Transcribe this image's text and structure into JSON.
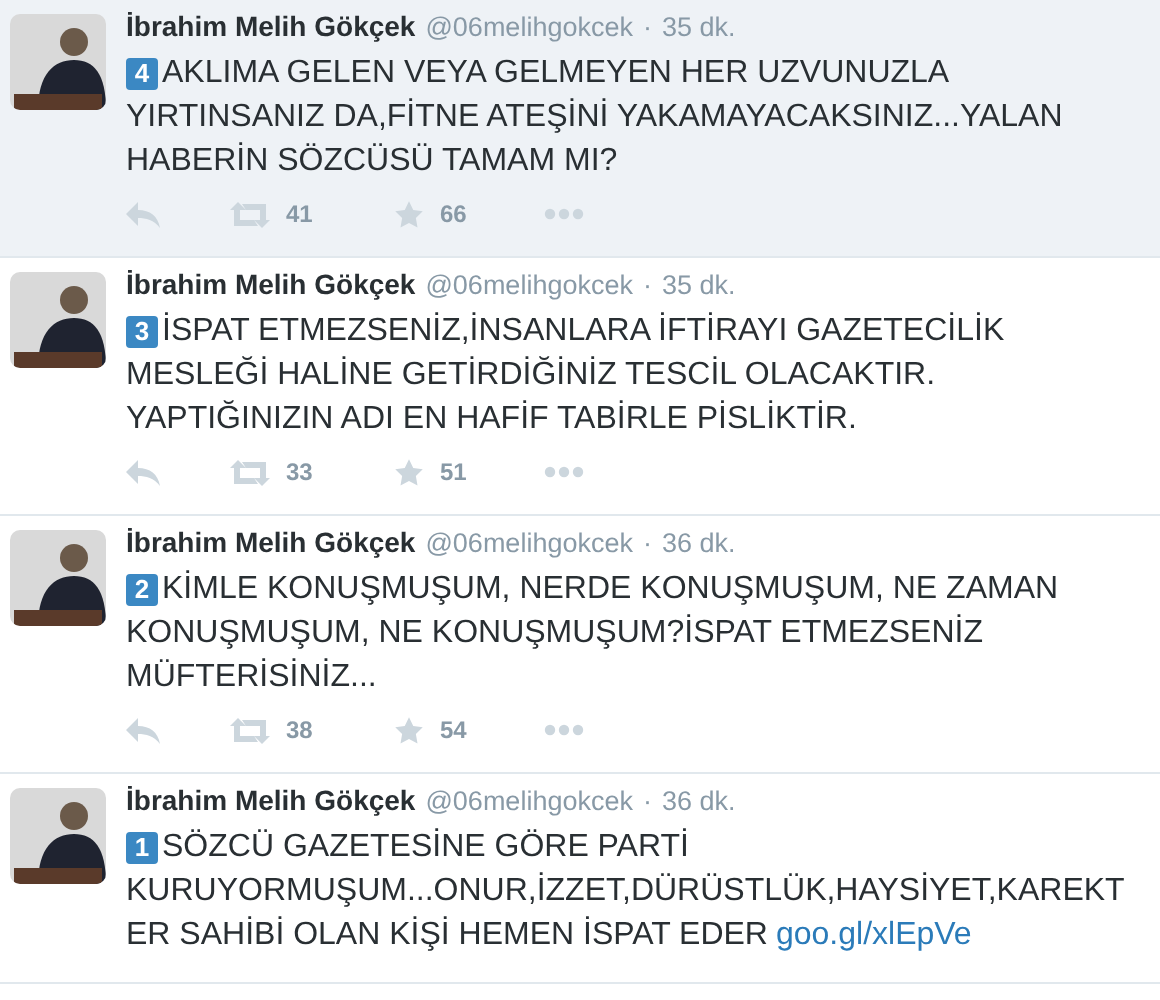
{
  "tweets": [
    {
      "name": "İbrahim Melih Gökçek",
      "handle": "@06melihgokcek",
      "separator": "·",
      "time": "35 dk.",
      "highlighted": true,
      "badge": "4",
      "lines": [
        "AKLIMA GELEN VEYA GELMEYEN HER UZVUNUZLA",
        "YIRTINSANIZ DA,FİTNE ATEŞİNİ YAKAMAYACAKSINIZ...YALAN",
        "HABERİN SÖZCÜSÜ TAMAM MI?"
      ],
      "retweets": "41",
      "favorites": "66"
    },
    {
      "name": "İbrahim Melih Gökçek",
      "handle": "@06melihgokcek",
      "separator": "·",
      "time": "35 dk.",
      "highlighted": false,
      "badge": "3",
      "lines": [
        "İSPAT ETMEZSENİZ,İNSANLARA İFTİRAYI GAZETECİLİK",
        "MESLEĞİ HALİNE GETİRDİĞİNİZ TESCİL OLACAKTIR.",
        "YAPTIĞINIZIN ADI EN HAFİF TABİRLE PİSLİKTİR."
      ],
      "retweets": "33",
      "favorites": "51"
    },
    {
      "name": "İbrahim Melih Gökçek",
      "handle": "@06melihgokcek",
      "separator": "·",
      "time": "36 dk.",
      "highlighted": false,
      "badge": "2",
      "lines": [
        "KİMLE KONUŞMUŞUM, NERDE KONUŞMUŞUM, NE ZAMAN",
        "KONUŞMUŞUM, NE KONUŞMUŞUM?İSPAT ETMEZSENİZ",
        "MÜFTERİSİNİZ..."
      ],
      "retweets": "38",
      "favorites": "54"
    },
    {
      "name": "İbrahim Melih Gökçek",
      "handle": "@06melihgokcek",
      "separator": "·",
      "time": "36 dk.",
      "highlighted": false,
      "badge": "1",
      "lines": [
        "SÖZCÜ GAZETESİNE GÖRE PARTİ",
        "KURUYORMUŞUM...ONUR,İZZET,DÜRÜSTLÜK,HAYSİYET,KAREKT",
        "ER SAHİBİ OLAN KİŞİ HEMEN İSPAT EDER"
      ],
      "link": "goo.gl/xlEpVe"
    }
  ]
}
